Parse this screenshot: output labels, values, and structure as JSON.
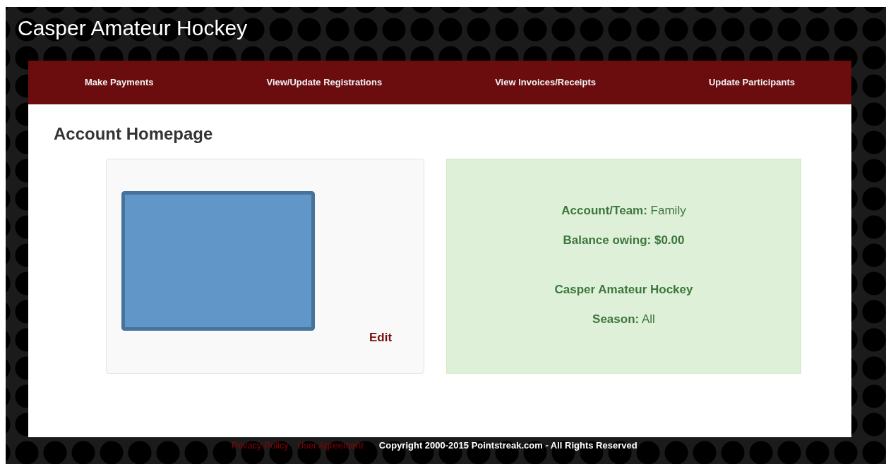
{
  "site_title": "Casper Amateur Hockey",
  "nav": [
    {
      "label": "Make Payments"
    },
    {
      "label": "View/Update Registrations"
    },
    {
      "label": "View Invoices/Receipts"
    },
    {
      "label": "Update Participants"
    }
  ],
  "heading": "Account Homepage",
  "profile_card": {
    "edit_link": "Edit"
  },
  "account_info": [
    [
      {
        "label": "Account/Team:",
        "value": "Family"
      },
      {
        "label": "Balance owing: $0.00"
      }
    ],
    [
      {
        "label": "Casper Amateur Hockey"
      },
      {
        "label": "Season:",
        "value": "All"
      }
    ]
  ],
  "footer": {
    "links": [
      "Privacy Policy",
      "User Agreement"
    ],
    "copyright": "Copyright 2000-2015 Pointstreak.com - All Rights Reserved"
  }
}
